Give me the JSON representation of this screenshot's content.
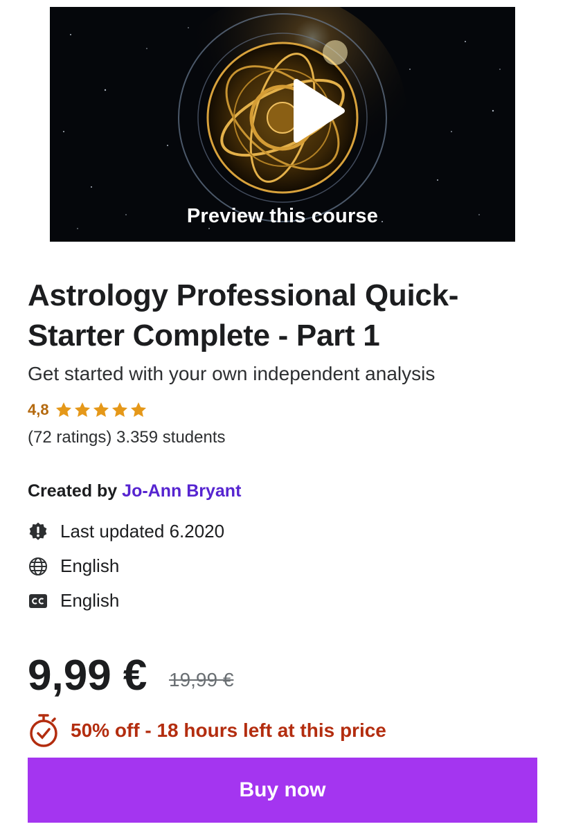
{
  "preview": {
    "label": "Preview this course"
  },
  "course": {
    "title": "Astrology Professional Quick-Starter Complete - Part 1",
    "subtitle": "Get started with your own independent analysis",
    "rating": "4,8",
    "stars": 5,
    "ratings_students": "(72 ratings) 3.359 students",
    "created_label": "Created by",
    "author": "Jo-Ann Bryant",
    "last_updated": "Last updated 6.2020",
    "language": "English",
    "captions": "English"
  },
  "pricing": {
    "price": "9,99 €",
    "original_price": "19,99 €",
    "discount": "50% off - 18 hours left at this price",
    "buy_label": "Buy now"
  },
  "colors": {
    "accent": "#a435f0",
    "author_link": "#5624d0",
    "rating": "#b4690e",
    "discount": "#b32d0f"
  },
  "icons": {
    "play": "play-icon",
    "updated": "alert-badge-icon",
    "language": "globe-icon",
    "captions": "closed-captions-icon",
    "timer": "stopwatch-icon",
    "star": "star-icon"
  }
}
